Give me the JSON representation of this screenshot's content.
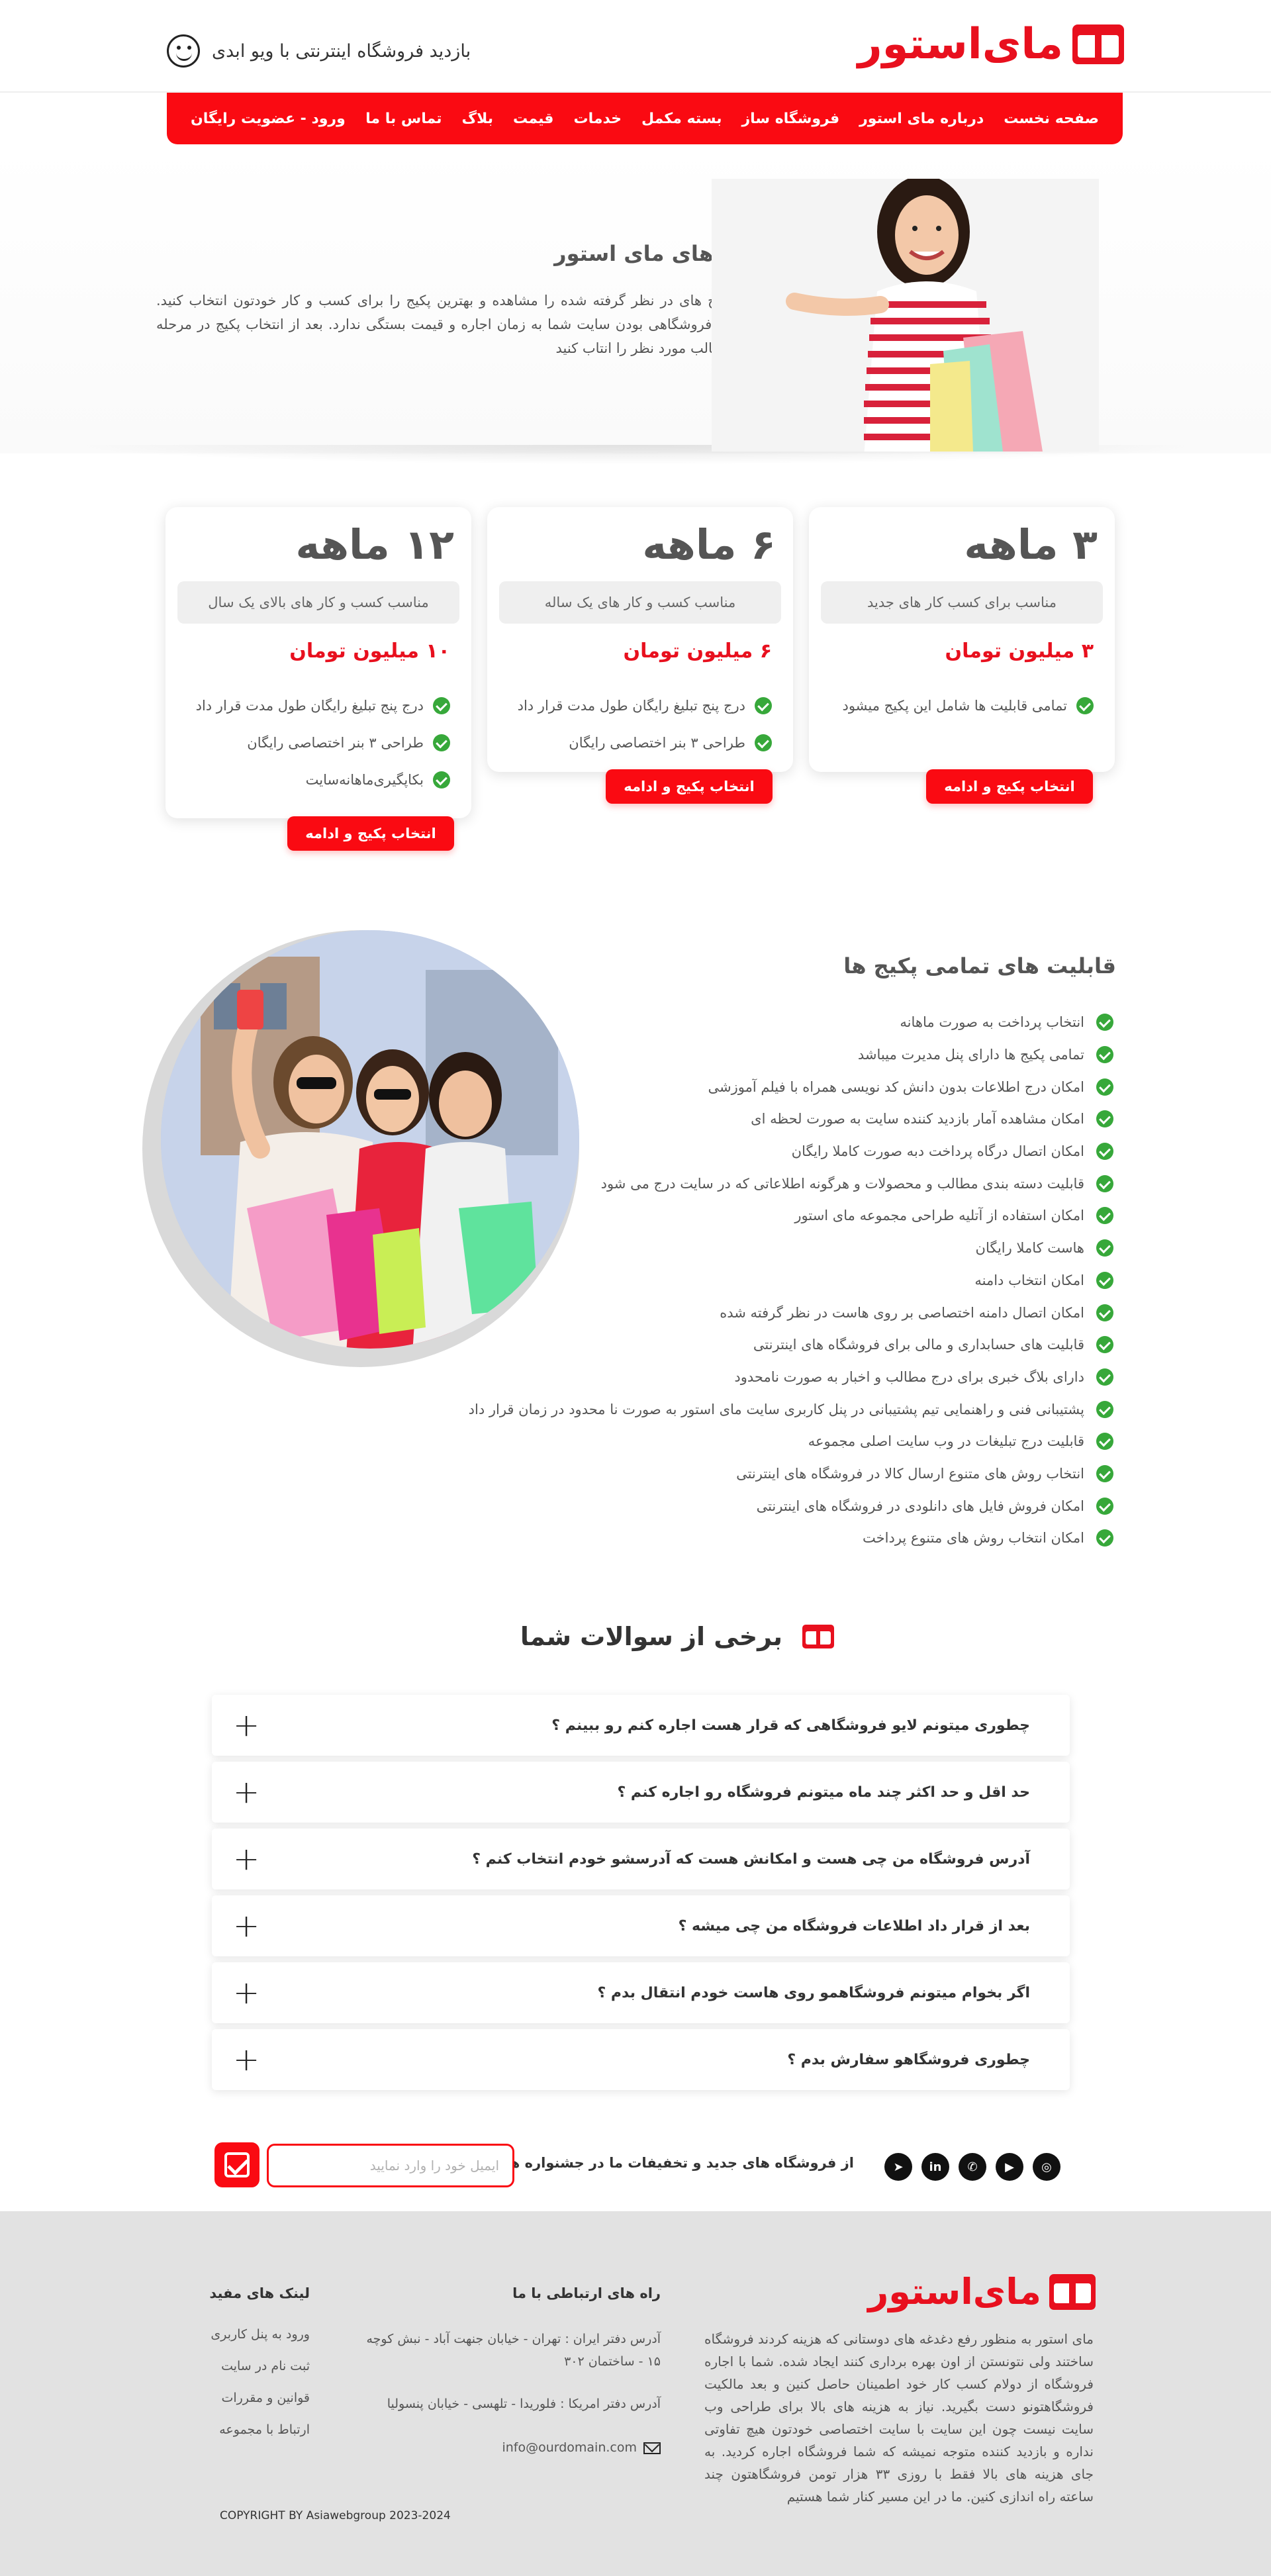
{
  "header": {
    "logo_text": "مای‌استور",
    "visit_text": "بازدید فروشگاه اینترنتی با ویو ابدی"
  },
  "nav": {
    "items": [
      "صفحه نخست",
      "درباره مای استور",
      "فروشگاه ساز",
      "بسته مکمل",
      "خدمات",
      "قیمت",
      "بلاگ",
      "تماس با ما"
    ],
    "login": "ورود - عضویت رایگان"
  },
  "hero": {
    "title": "پکیج های مای استور",
    "description": "لطفا پکیج های در نظر گرفته شده را مشاهده و بهترین پکیج را برای کسب و کار خودتون انتخاب کنید. تجاری یا فروشگاهی بودن سایت شما به زمان اجاره و قیمت بستگی ندارد. بعد از انتخاب پکیج در مرحله بعد نوع قالب مورد نظر را انتاب کنید"
  },
  "packages": [
    {
      "months": "۳ ماهه",
      "subtitle": "مناسب برای کسب کار های جدید",
      "price": "۳ میلیون تومان",
      "features": [
        "تمامی قابلیت ها شامل این پکیج میشود"
      ],
      "button": "انتخاب پکیج و ادامه"
    },
    {
      "months": "۶ ماهه",
      "subtitle": "مناسب کسب و کار های یک ساله",
      "price": "۶ میلیون تومان",
      "features": [
        "درج پنج  تبلیغ رایگان  طول مدت قرار داد",
        "طراحی ۳ بنر اختصاصی رایگان"
      ],
      "button": "انتخاب پکیج و ادامه"
    },
    {
      "months": "۱۲ ماهه",
      "subtitle": "مناسب کسب و کار های بالای یک سال",
      "price": "۱۰ میلیون تومان",
      "features": [
        "درج پنج  تبلیغ رایگان  طول مدت قرار داد",
        "طراحی ۳ بنر اختصاصی رایگان",
        "بکاپگیری‌ماهانه‌سایت"
      ],
      "button": "انتخاب پکیج و ادامه"
    }
  ],
  "features": {
    "title": "قابلیت های تمامی پکیج ها",
    "items": [
      "انتخاب پرداخت به صورت ماهانه",
      "تمامی پکیج ها دارای پنل مدیرت میباشد",
      "امکان درج اطلاعات بدون دانش کد نویسی همراه با فیلم آموزشی",
      "امکان مشاهده آمار بازدید کننده سایت به صورت لحظه ای",
      "امکان اتصال درگاه پرداخت دبه صورت کاملا رایگان",
      "قابلیت دسته بندی مطالب و محصولات و هرگونه اطلاعاتی که در سایت درج می شود",
      "امکان استفاده از آتلیه طراحی مجموعه مای استور",
      "هاست کاملا رایگان",
      "امکان انتخاب دامنه",
      "امکان اتصال دامنه اختصاصی بر روی هاست در نظر گرفته شده",
      "قابلیت های حسابداری و مالی برای فروشگاه های اینترنتی",
      "دارای بلاگ خبری برای درج مطالب و اخبار به صورت نامحدود",
      "پشتیبانی فنی و راهنمایی تیم پشتیبانی در پنل کاربری سایت مای استور به صورت نا محدود در زمان قرار داد",
      "قابلیت درج تبلیغات در وب سایت اصلی مجموعه",
      "انتخاب روش های متنوع ارسال کالا در فروشگاه های اینترنتی",
      "امکان فروش فایل های دانلودی در فروشگاه های اینترنتی",
      "امکان انتخاب روش های متنوع پرداخت"
    ]
  },
  "faq": {
    "title": "برخی از سوالات شما",
    "items": [
      "چطوری میتونم لایو فروشگاهی که قرار هست اجاره کنم رو ببینم ؟",
      "حد اقل و حد اکثر چند ماه میتونم فروشگاه رو اجاره کنم ؟",
      "آدرس فروشگاه من چی هست و امکانش هست که آدرسشو خودم انتخاب کنم ؟",
      "بعد از قرار داد اطلاعات فروشگاه من چی میشه ؟",
      "اگر بخوام میتونم فروشگاهمو روی هاست خودم انتقال بدم ؟",
      "چطوری فروشگاهو سفارش بدم ؟"
    ]
  },
  "newsletter": {
    "text": "از فروشگاه های جدید و تخفیفات ما در جشنواره ها مطلع شوید",
    "placeholder": "ایمیل خود را وارد نمایید",
    "socials": [
      "telegram-icon",
      "linkedin-icon",
      "whatsapp-icon",
      "youtube-icon",
      "instagram-icon"
    ]
  },
  "footer": {
    "logo_text": "مای‌استور",
    "about": "مای استور به منظور رفع دغدغه های دوستانی که هزینه کردند فروشگاه ساختند ولی نتونستن از اون بهره برداری کنند ایجاد شده. شما با اجاره فروشگاه از دولام کسب کار خود اطمینان حاصل کنین و بعد مالکیت فروشگاهتونو دست بگیرید. نیاز به هزینه های بالا برای طراحی وب سایت نیست چون این سایت با سایت اختصاصی خودتون هیچ تفاوتی نداره و بازدید کننده متوجه نمیشه که شما فروشگاه اجاره کردید. به جای هزینه های بالا فقط با روزی ۳۳ هزار تومن فروشگاهتون چند ساعته راه اندازی کنین. ما در این مسیر کنار شما هستیم",
    "contact_title": "راه های ارتباطی با ما",
    "address_iran": "آدرس دفتر ایران : تهران - خیابان جنهت آباد - نبش کوچه ۱۵ - ساختمان ۳۰۲",
    "address_usa": "آدرس دفتر امریکا : فلوریدا - تلهسی - خیابان پنسولیا",
    "email": "info@ourdomain.com",
    "links_title": "لینک های مفید",
    "links": [
      "ورود به پنل کاربری",
      "ثبت نام در سایت",
      "قوانین و مقررات",
      "ارتباط با مجموعه"
    ],
    "copyright": "COPYRIGHT BY Asiawebgroup  2023-2024"
  },
  "colors": {
    "brand": "#fa0a12",
    "check": "#37a83a",
    "footer_bg": "#e2e2e2"
  }
}
